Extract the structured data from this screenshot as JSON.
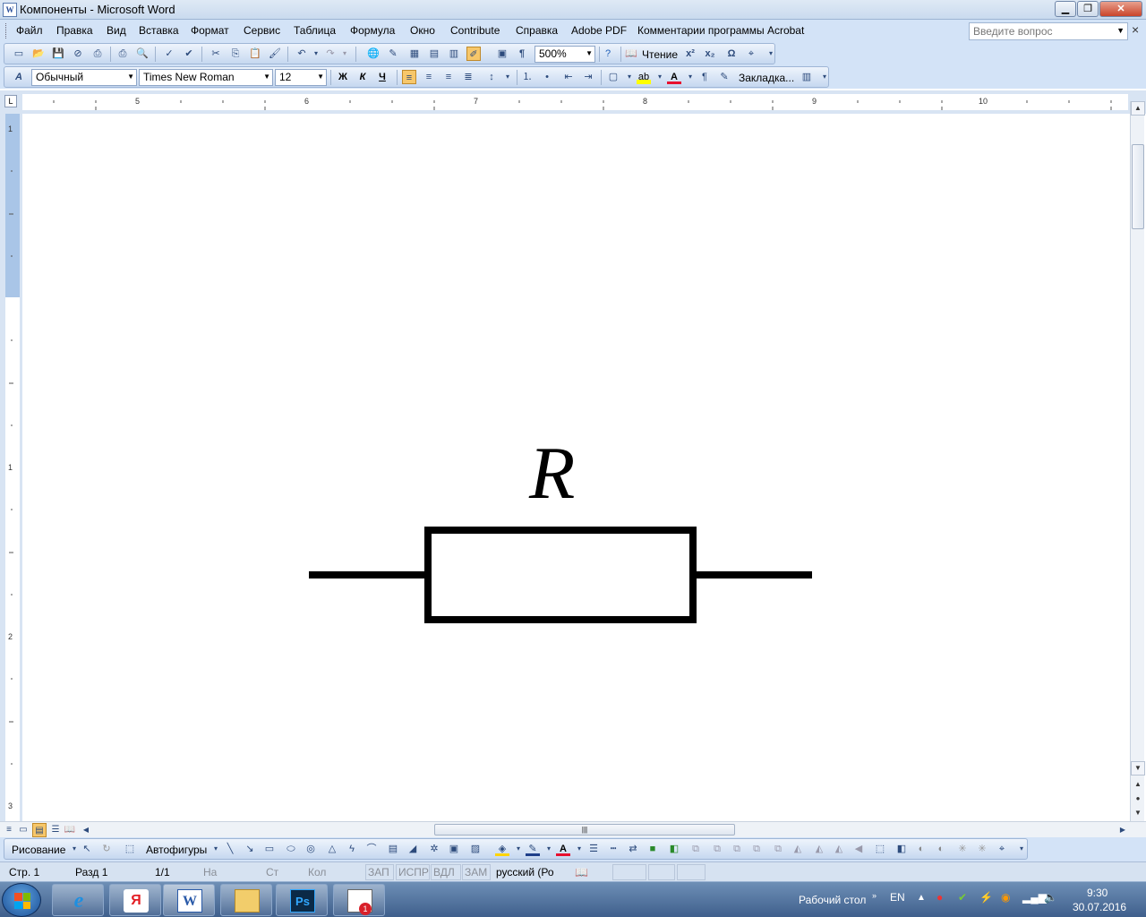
{
  "window": {
    "title": "Компоненты - Microsoft Word",
    "app_icon": "W"
  },
  "menu": {
    "items": [
      "Файл",
      "Правка",
      "Вид",
      "Вставка",
      "Формат",
      "Сервис",
      "Таблица",
      "Формула",
      "Окно",
      "Contribute",
      "Справка",
      "Adobe PDF",
      "Комментарии программы Acrobat"
    ],
    "ask_placeholder": "Введите вопрос"
  },
  "standard_toolbar": {
    "zoom": "500%",
    "reading_label": "Чтение",
    "icons": [
      "new-icon",
      "open-icon",
      "save-icon",
      "permission-icon",
      "print-icon",
      "print-preview-icon",
      "spelling-icon",
      "research-icon",
      "cut-icon",
      "copy-icon",
      "paste-icon",
      "format-painter-icon",
      "undo-icon",
      "redo-icon",
      "hyperlink-icon",
      "tables-borders-icon",
      "insert-table-icon",
      "insert-excel-icon",
      "columns-icon",
      "drawing-icon",
      "document-map-icon",
      "show-formatting-icon",
      "help-icon",
      "superscript-icon",
      "subscript-icon",
      "symbol-icon"
    ]
  },
  "formatting_toolbar": {
    "style": "Обычный",
    "font": "Times New Roman",
    "size": "12",
    "bold": "Ж",
    "italic": "К",
    "underline": "Ч",
    "bookmark_label": "Закладка..."
  },
  "ruler": {
    "h_numbers": [
      "5",
      "6",
      "7",
      "8",
      "9",
      "10"
    ],
    "v_numbers": [
      "1",
      "1",
      "2",
      "3"
    ]
  },
  "document": {
    "label_text": "R"
  },
  "drawing_toolbar": {
    "drawing_label": "Рисование",
    "autoshapes_label": "Автофигуры"
  },
  "status": {
    "page": "Стр. 1",
    "section": "Разд 1",
    "pages": "1/1",
    "at": "На",
    "line": "Ст",
    "col": "Кол",
    "rec": "ЗАП",
    "trk": "ИСПР",
    "ext": "ВДЛ",
    "ovr": "ЗАМ",
    "language": "русский (Ро"
  },
  "taskbar": {
    "desktop_label": "Рабочий стол",
    "lang": "EN",
    "time": "9:30",
    "date": "30.07.2016",
    "apps": [
      "internet-explorer",
      "yandex-browser",
      "microsoft-word",
      "file-explorer",
      "photoshop",
      "document-viewer"
    ],
    "notification_badge": "1"
  }
}
